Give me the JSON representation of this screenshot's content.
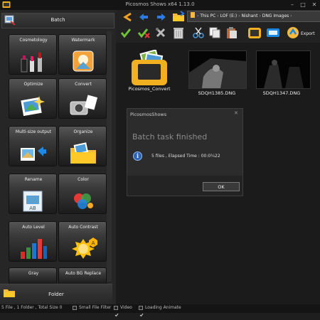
{
  "window": {
    "title": "Picosmos Shows x64 1.13.0",
    "min": "–",
    "max": "□",
    "close": "✕"
  },
  "left_panel": {
    "header": "Batch",
    "tools": [
      {
        "label": "Cosmetology"
      },
      {
        "label": "Watermark"
      },
      {
        "label": "Optimize"
      },
      {
        "label": "Convert"
      },
      {
        "label": "Multi-size output"
      },
      {
        "label": "Organize"
      },
      {
        "label": "Rename"
      },
      {
        "label": "Color"
      },
      {
        "label": "Auto Level"
      },
      {
        "label": "Auto Contrast"
      },
      {
        "label": "Gray"
      },
      {
        "label": "Auto BG Replace"
      }
    ],
    "footer": "Folder"
  },
  "breadcrumb": [
    "This PC",
    "LOF (E:)",
    "Nishant",
    "DNG Images"
  ],
  "toolbar": {
    "export_label": "Export"
  },
  "files": [
    {
      "name": "Picosmos_Convert"
    },
    {
      "name": "SDQH1385.DNG"
    },
    {
      "name": "SDQH1347.DNG"
    }
  ],
  "dialog": {
    "title": "PicosmosShows",
    "close": "✕",
    "heading": "Batch task finished",
    "message": "5 files , Elapsed Time : 00:0¼22",
    "ok_label": "OK"
  },
  "status": {
    "summary": "5 File , 1 Folder , Total Size 0",
    "small_file_filter": "Small File Filter",
    "video": "Video",
    "loading_animate": "Loading Animate",
    "small_file_filter_checked": false,
    "video_checked": true,
    "loading_animate_checked": true
  },
  "colors": {
    "accent": "#f0b020",
    "check_green": "#6fc23a",
    "info_blue": "#2a64b8"
  }
}
